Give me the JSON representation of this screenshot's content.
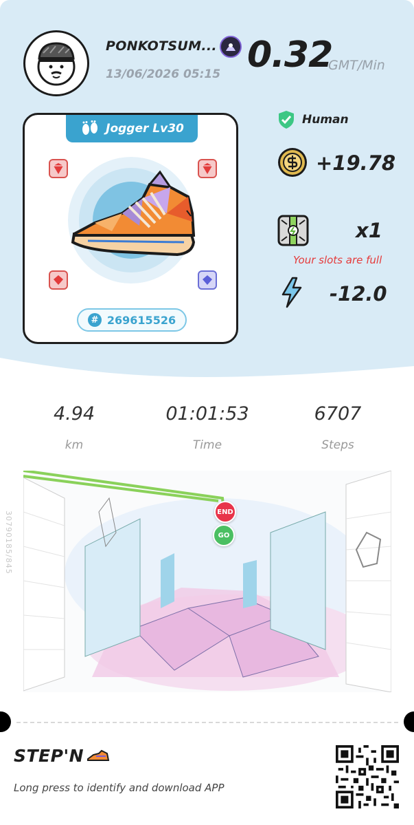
{
  "user": {
    "name": "PONKOTSUM...",
    "datetime": "13/06/2026 05:15"
  },
  "earning_rate": {
    "value": "0.32",
    "unit": "GMT/Min"
  },
  "sneaker": {
    "type_label": "Jogger Lv30",
    "id": "269615526",
    "gems": [
      "ruby",
      "ruby",
      "ruby",
      "sapphire"
    ]
  },
  "stats_right": {
    "human_label": "Human",
    "gmt_earned": "+19.78",
    "mystery_box_count": "x1",
    "slots_message": "Your slots are full",
    "energy": "-12.0"
  },
  "workout": {
    "distance": "4.94",
    "distance_unit": "km",
    "time": "01:01:53",
    "time_label": "Time",
    "steps": "6707",
    "steps_label": "Steps"
  },
  "map": {
    "end_label": "END",
    "go_label": "GO",
    "side_code": "30790185/845"
  },
  "footer": {
    "logo_text": "STEP'N",
    "instruction": "Long press to identify and download APP"
  },
  "colors": {
    "top_bg": "#d9ebf6",
    "accent_blue": "#3aa3cf",
    "route_green": "#8ad15a",
    "end_red": "#e8344a",
    "go_green": "#4bbf62",
    "warning_red": "#e53a3a"
  }
}
